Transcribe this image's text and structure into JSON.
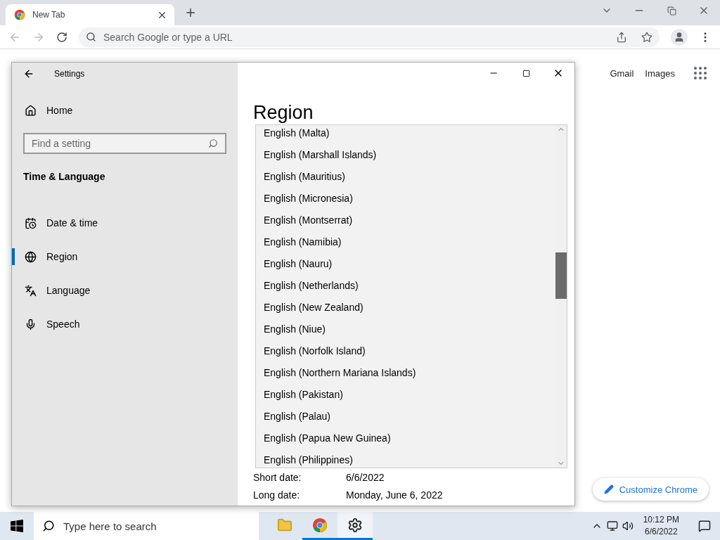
{
  "browser": {
    "tabs": [
      {
        "title": "New Tab",
        "selected": true
      }
    ],
    "omnibox": {
      "placeholder": "Search Google or type a URL"
    }
  },
  "page": {
    "links": [
      "Gmail",
      "Images"
    ],
    "customize_button": "Customize Chrome"
  },
  "settings": {
    "title": "Settings",
    "home": "Home",
    "search": {
      "placeholder": "Find a setting"
    },
    "section": "Time & Language",
    "nav": [
      {
        "label": "Date & time",
        "selected": false
      },
      {
        "label": "Region",
        "selected": true
      },
      {
        "label": "Language",
        "selected": false
      },
      {
        "label": "Speech",
        "selected": false
      }
    ],
    "heading": "Region",
    "dropdown": {
      "items": [
        "English (Malta)",
        "English (Marshall Islands)",
        "English (Mauritius)",
        "English (Micronesia)",
        "English (Montserrat)",
        "English (Namibia)",
        "English (Nauru)",
        "English (Netherlands)",
        "English (New Zealand)",
        "English (Niue)",
        "English (Norfolk Island)",
        "English (Northern Mariana Islands)",
        "English (Pakistan)",
        "English (Palau)",
        "English (Papua New Guinea)",
        "English (Philippines)"
      ]
    },
    "formats": [
      {
        "label": "Short date:",
        "value": "6/6/2022"
      },
      {
        "label": "Long date:",
        "value": "Monday, June 6, 2022"
      }
    ]
  },
  "taskbar": {
    "search": {
      "placeholder": "Type here to search"
    },
    "apps": [
      {
        "kind": "explorer",
        "running": false,
        "selected": false
      },
      {
        "kind": "chrome",
        "running": true,
        "selected": false
      },
      {
        "kind": "settings",
        "running": true,
        "selected": true
      }
    ],
    "time": "10:12 PM",
    "date": "6/6/2022"
  }
}
